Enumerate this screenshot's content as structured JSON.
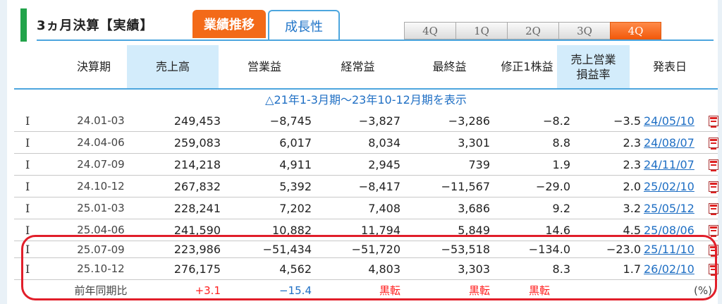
{
  "header": {
    "title": "3ヵ月決算【実績】",
    "tab_performance": "業績推移",
    "tab_growth": "成長性"
  },
  "quarter_tabs": [
    "4Q",
    "1Q",
    "2Q",
    "3Q",
    "4Q"
  ],
  "active_quarter_index": 4,
  "columns": {
    "period": "決算期",
    "sales": "売上高",
    "operating": "営業益",
    "ordinary": "経常益",
    "net": "最終益",
    "eps": "修正1株益",
    "margin_line1": "売上営業",
    "margin_line2": "損益率",
    "announce": "発表日"
  },
  "range_text": "△21年1-3月期～23年10-12月期を表示",
  "rows": [
    {
      "mark": "I",
      "period": "24.01-03",
      "sales": "249,453",
      "operating": "−8,745",
      "ordinary": "−3,827",
      "net": "−3,286",
      "eps": "−8.2",
      "margin": "−3.5",
      "date": "24/05/10"
    },
    {
      "mark": "I",
      "period": "24.04-06",
      "sales": "259,083",
      "operating": "6,017",
      "ordinary": "8,034",
      "net": "3,301",
      "eps": "8.8",
      "margin": "2.3",
      "date": "24/08/07"
    },
    {
      "mark": "I",
      "period": "24.07-09",
      "sales": "214,218",
      "operating": "4,911",
      "ordinary": "2,945",
      "net": "739",
      "eps": "1.9",
      "margin": "2.3",
      "date": "24/11/07"
    },
    {
      "mark": "I",
      "period": "24.10-12",
      "sales": "267,832",
      "operating": "5,392",
      "ordinary": "−8,417",
      "net": "−11,567",
      "eps": "−29.0",
      "margin": "2.0",
      "date": "25/02/10"
    },
    {
      "mark": "I",
      "period": "25.01-03",
      "sales": "228,241",
      "operating": "7,202",
      "ordinary": "7,408",
      "net": "3,686",
      "eps": "9.2",
      "margin": "3.2",
      "date": "25/05/12"
    },
    {
      "mark": "I",
      "period": "25.04-06",
      "sales": "241,590",
      "operating": "10,882",
      "ordinary": "11,794",
      "net": "5,849",
      "eps": "14.6",
      "margin": "4.5",
      "date": "25/08/06"
    },
    {
      "mark": "I",
      "period": "25.07-09",
      "sales": "223,986",
      "operating": "−51,434",
      "ordinary": "−51,720",
      "net": "−53,518",
      "eps": "−134.0",
      "margin": "−23.0",
      "date": "25/11/10"
    },
    {
      "mark": "I",
      "period": "25.10-12",
      "sales": "276,175",
      "operating": "4,562",
      "ordinary": "4,803",
      "net": "3,303",
      "eps": "8.3",
      "margin": "1.7",
      "date": "26/02/10"
    }
  ],
  "yoy": {
    "label": "前年同期比",
    "sales": "+3.1",
    "operating": "−15.4",
    "ordinary": "黒転",
    "net": "黒転",
    "eps": "黒転",
    "unit": "(%)"
  },
  "colors": {
    "accent_green": "#22a34a",
    "tab_orange": "#f36a18",
    "tab_blue": "#4da6de",
    "header_blue_bg": "#d3ecfb",
    "link_blue": "#1f6fc4",
    "positive_red": "#ff1e1e",
    "highlight_red": "#e11e2a"
  },
  "icons": {
    "announce_doc": "pdf-icon"
  }
}
